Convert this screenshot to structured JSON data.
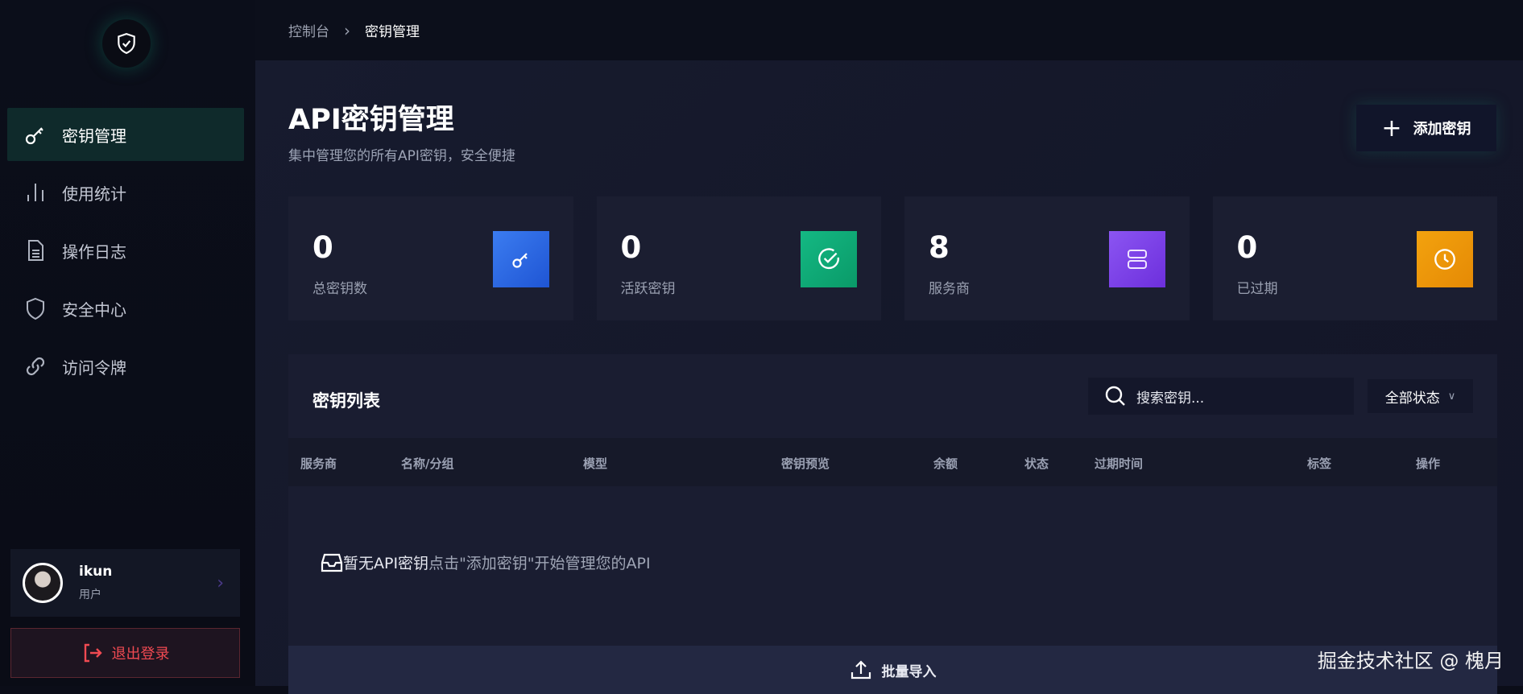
{
  "sidebar": {
    "items": [
      {
        "label": "密钥管理",
        "icon": "key-icon"
      },
      {
        "label": "使用统计",
        "icon": "bar-chart-icon"
      },
      {
        "label": "操作日志",
        "icon": "document-icon"
      },
      {
        "label": "安全中心",
        "icon": "shield-icon"
      },
      {
        "label": "访问令牌",
        "icon": "link-icon"
      }
    ],
    "user": {
      "name": "ikun",
      "role": "用户"
    },
    "logout": "退出登录"
  },
  "breadcrumb": {
    "root": "控制台",
    "current": "密钥管理"
  },
  "page": {
    "title": "API密钥管理",
    "subtitle": "集中管理您的所有API密钥，安全便捷",
    "add_button": "添加密钥"
  },
  "stats": [
    {
      "value": "0",
      "label": "总密钥数",
      "color": "#2f6fe6"
    },
    {
      "value": "0",
      "label": "活跃密钥",
      "color": "#12b07a"
    },
    {
      "value": "8",
      "label": "服务商",
      "color": "#7b3fe8"
    },
    {
      "value": "0",
      "label": "已过期",
      "color": "#f09a0c"
    }
  ],
  "list": {
    "title": "密钥列表",
    "search_placeholder": "搜索密钥...",
    "filter": "全部状态",
    "columns": [
      "服务商",
      "名称/分组",
      "模型",
      "密钥预览",
      "余额",
      "状态",
      "过期时间",
      "标签",
      "操作"
    ],
    "empty_title": "暂无API密钥",
    "empty_text": "点击\"添加密钥\"开始管理您的API",
    "import": "批量导入"
  },
  "watermark": "掘金技术社区 @ 槐月"
}
